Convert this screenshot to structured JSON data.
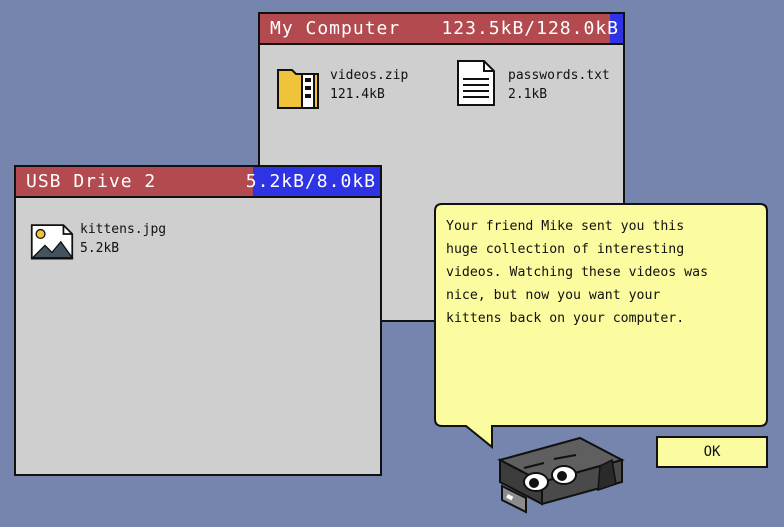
{
  "windows": {
    "my_computer": {
      "title": "My Computer",
      "usage": "123.5kB/128.0kB",
      "usage_fraction": 0.965,
      "files": [
        {
          "name": "videos.zip",
          "size": "121.4kB",
          "icon": "zip-folder-icon"
        },
        {
          "name": "passwords.txt",
          "size": "2.1kB",
          "icon": "text-file-icon"
        }
      ]
    },
    "usb_drive": {
      "title": "USB Drive 2",
      "usage": "5.2kB/8.0kB",
      "usage_fraction": 0.65,
      "files": [
        {
          "name": "kittens.jpg",
          "size": "5.2kB",
          "icon": "image-file-icon"
        }
      ]
    }
  },
  "dialog": {
    "message": "Your friend Mike sent you this\nhuge collection of interesting\nvideos. Watching these videos was\nnice, but now you want your\nkittens back on your computer.",
    "ok_label": "OK",
    "speaker_icon": "usb-stick-character-icon"
  },
  "colors": {
    "background": "#7585ad",
    "titlebar": "#b24a4f",
    "usage_fill": "#2f33e6",
    "bubble": "#fbfb9f"
  }
}
